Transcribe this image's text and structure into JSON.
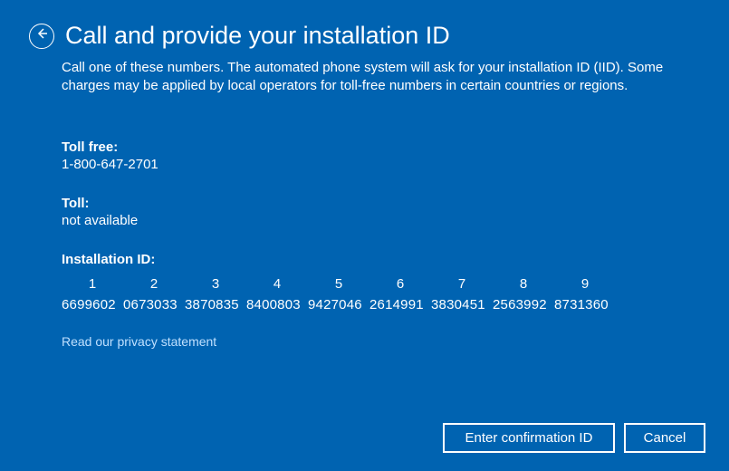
{
  "header": {
    "title": "Call and provide your installation ID"
  },
  "description": "Call one of these numbers. The automated phone system will ask for your installation ID (IID). Some charges may be applied by local operators for toll-free numbers in certain countries or regions.",
  "toll_free": {
    "label": "Toll free:",
    "value": "1-800-647-2701"
  },
  "toll": {
    "label": "Toll:",
    "value": "not available"
  },
  "installation_id": {
    "label": "Installation ID:",
    "columns": [
      "1",
      "2",
      "3",
      "4",
      "5",
      "6",
      "7",
      "8",
      "9"
    ],
    "groups": [
      "6699602",
      "0673033",
      "3870835",
      "8400803",
      "9427046",
      "2614991",
      "3830451",
      "2563992",
      "8731360"
    ]
  },
  "privacy_link": "Read our privacy statement",
  "buttons": {
    "enter_confirmation": "Enter confirmation ID",
    "cancel": "Cancel"
  }
}
